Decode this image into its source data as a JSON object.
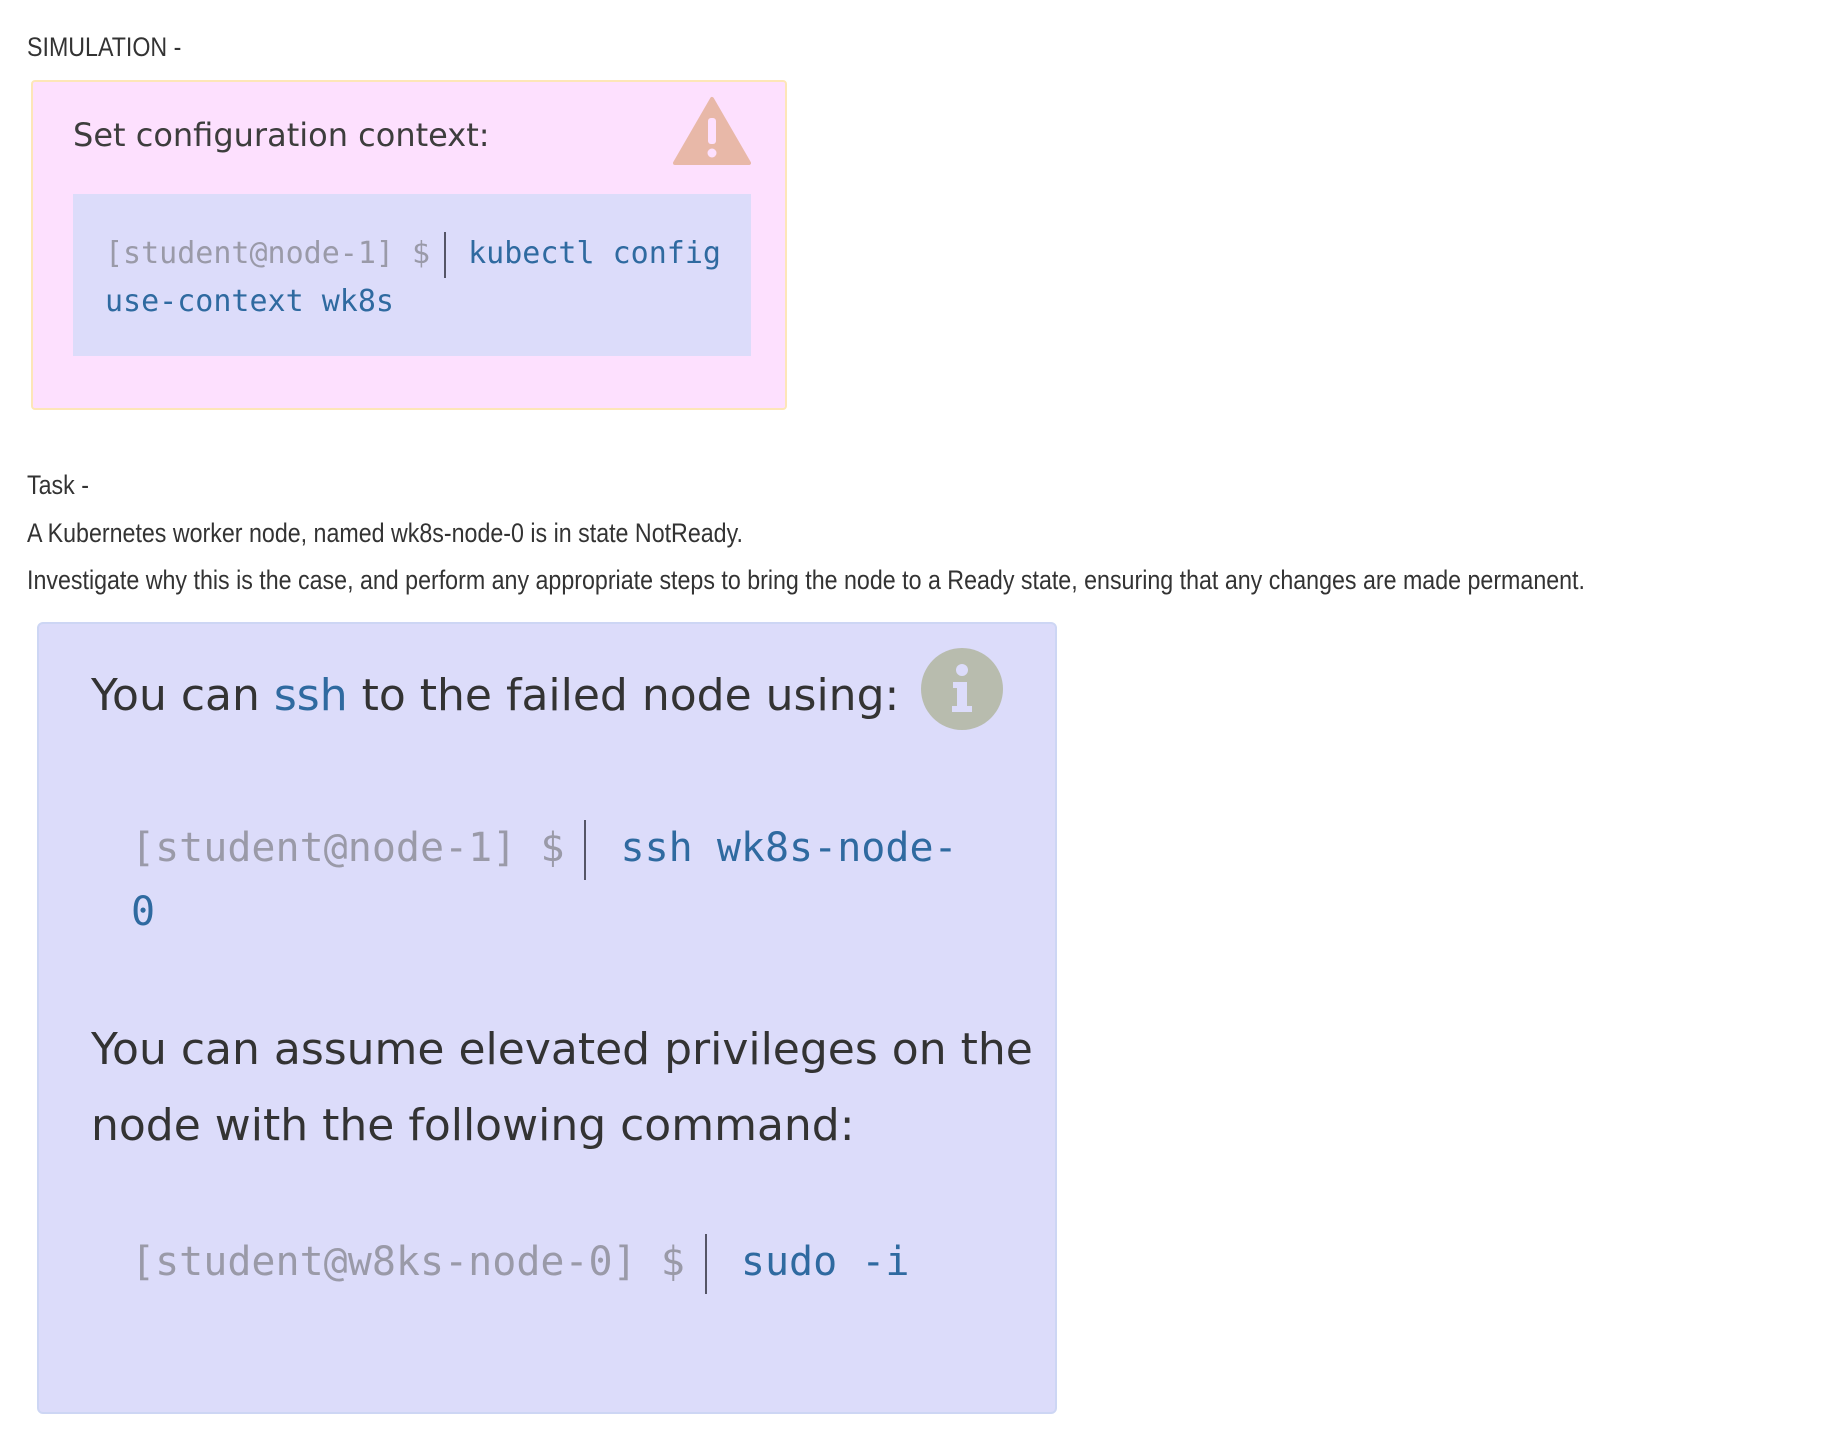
{
  "heading": "SIMULATION -",
  "config_box": {
    "title": "Set configuration context:",
    "icon": "warning-icon",
    "prompt": "[student@node-1] $",
    "command_line1": "kubectl config",
    "command_line2": "use-context wk8s"
  },
  "task": {
    "heading": "Task -",
    "line1": "A Kubernetes worker node, named wk8s-node-0 is in state NotReady.",
    "line2": "Investigate why this is the case, and perform any appropriate steps to bring the node to a Ready state, ensuring that any changes are made permanent."
  },
  "info_box": {
    "icon": "info-icon",
    "line1_before": "You can",
    "line1_code": "ssh",
    "line1_after": "to the failed node using:",
    "ssh_prompt": "[student@node-1] $",
    "ssh_command_line1": "ssh wk8s-node-",
    "ssh_command_line2": "0",
    "line2": "You can assume elevated privileges on the",
    "line3": "node with the following command:",
    "sudo_prompt": "[student@w8ks-node-0] $",
    "sudo_command": "sudo -i"
  },
  "colors": {
    "warn_bg": "#fde0fe",
    "code_bg": "#dcdcfa",
    "command": "#2f6aa0",
    "prompt": "#9a9aa8",
    "warn_icon": "#e8b8a8",
    "info_icon": "#b8bcae"
  }
}
